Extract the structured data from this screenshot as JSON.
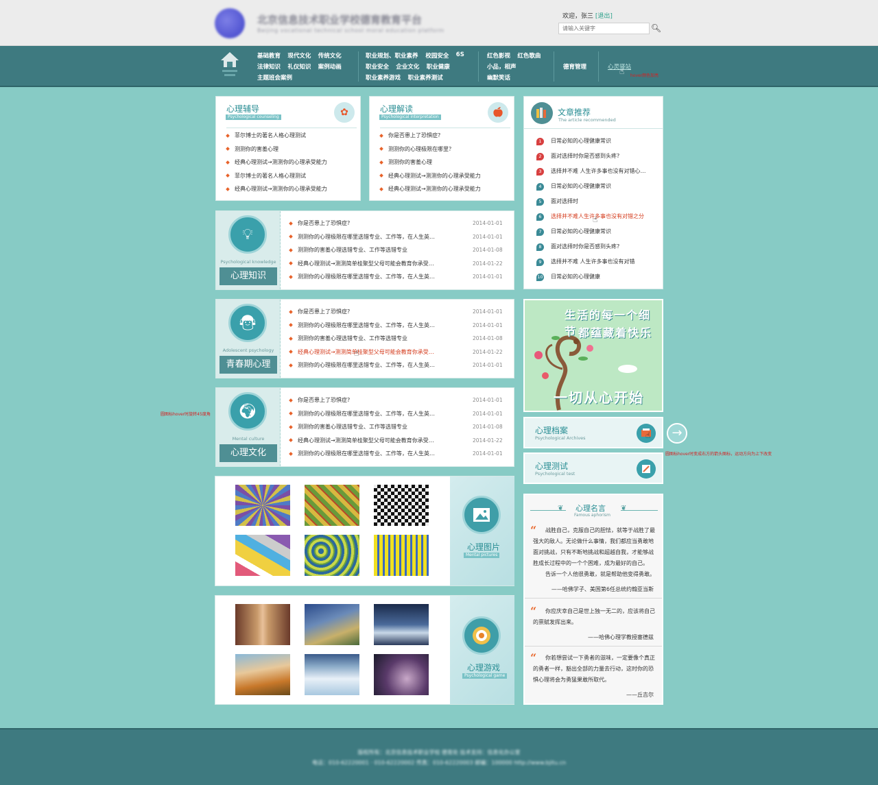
{
  "header": {
    "site_title": "北京信息技术职业学校德育教育平台",
    "site_subtitle": "Beijing vocational technical school moral education platform",
    "welcome": "欢迎，张三",
    "logout": "[退出]",
    "search_placeholder": "请输入关键字"
  },
  "nav": {
    "g1": [
      [
        "基础教育",
        "现代文化",
        "传统文化"
      ],
      [
        "法律知识",
        "礼仪知识",
        "案例动画"
      ],
      [
        "主题班会案例"
      ]
    ],
    "g2": [
      [
        "职业规划、职业素养",
        "校园安全",
        "6S"
      ],
      [
        "职业安全",
        "企业文化",
        "职业健康"
      ],
      [
        "职业素养游戏",
        "职业素养测试"
      ]
    ],
    "g3": [
      [
        "红色影视",
        "红色歌曲"
      ],
      [
        "小品，相声"
      ],
      [
        "幽默笑话"
      ]
    ],
    "g4": "德育管理",
    "g5": "心灵驿站",
    "hover_note": "hover颜色加亮"
  },
  "counseling": {
    "title": "心理辅导",
    "subtitle": "Psychological counseling",
    "items": [
      "菲尔博士的著名人格心理测试",
      "测测你的害羞心理",
      "经典心理测试→测测你的心理承受能力",
      "菲尔博士的著名人格心理测试",
      "经典心理测试→测测你的心理承受能力"
    ]
  },
  "interpretation": {
    "title": "心理解读",
    "subtitle": "Psychological interpretation",
    "items": [
      "你是否患上了恐惧症?",
      "测测你的心理极限在哪里？",
      "测测你的害羞心理",
      "经典心理测试→测测你的心理承受能力",
      "经典心理测试→测测你的心理承受能力"
    ]
  },
  "sections": [
    {
      "en": "Psychological knowledge",
      "title": "心理知识",
      "rows": [
        [
          "你是否患上了恐惧症?",
          "2014-01-01"
        ],
        [
          "测测你的心理极限在哪里选错专业、工作等，在人生英…",
          "2014-01-01"
        ],
        [
          "测测你的害羞心理选错专业、工作等选错专业",
          "2014-01-08"
        ],
        [
          "经典心理测试→测测简单桂聚型父母可能会教育你承受…",
          "2014-01-22"
        ],
        [
          "测测你的心理极限在哪里选错专业、工作等，在人生英…",
          "2014-01-01"
        ]
      ]
    },
    {
      "en": "Adolescent psychology",
      "title": "青春期心理",
      "rows": [
        [
          "你是否患上了恐惧症?",
          "2014-01-01"
        ],
        [
          "测测你的心理极限在哪里选错专业、工作等，在人生英…",
          "2014-01-01"
        ],
        [
          "测测你的害羞心理选错专业、工作等选错专业",
          "2014-01-08"
        ],
        [
          "经典心理测试→测测简单桂聚型父母可能会教育你承受…",
          "2014-01-22"
        ],
        [
          "测测你的心理极限在哪里选错专业、工作等，在人生英…",
          "2014-01-01"
        ]
      ]
    },
    {
      "en": "Mental culture",
      "title": "心理文化",
      "rows": [
        [
          "你是否患上了恐惧症?",
          "2014-01-01"
        ],
        [
          "测测你的心理极限在哪里选错专业、工作等，在人生英…",
          "2014-01-01"
        ],
        [
          "测测你的害羞心理选错专业、工作等选错专业",
          "2014-01-08"
        ],
        [
          "经典心理测试→测测简单桂聚型父母可能会教育你承受…",
          "2014-01-22"
        ],
        [
          "测测你的心理极限在哪里选错专业、工作等，在人生英…",
          "2014-01-01"
        ]
      ]
    }
  ],
  "annot_left": "圆图标hover时旋转45度角",
  "annot_right": "圆图标hover时变成右方的箭头图标，运动方向为上下改变",
  "pictures": {
    "title": "心理图片",
    "subtitle": "Mental pictures"
  },
  "games": {
    "title": "心理游戏",
    "subtitle": "Psychological game"
  },
  "recommend": {
    "title": "文章推荐",
    "subtitle": "The article recommended",
    "items": [
      "日常必知的心理健康常识",
      "面对选择时你是否感到头疼?",
      "选择并不难 人生许多事也没有对错心…",
      "日常必知的心理健康常识",
      "面对选择时",
      "选择并不难人生许多事也没有对错之分",
      "日常必知的心理健康常识",
      "面对选择时你是否感到头疼?",
      "选择并不难 人生许多事也没有对错",
      "日常必知的心理健康"
    ],
    "numbers": [
      "1",
      "2",
      "3",
      "4",
      "5",
      "6",
      "7",
      "8",
      "9",
      "10"
    ]
  },
  "banner": {
    "line1": "生活的每一个细节",
    "line2": "都蕴藏着快乐",
    "line3": "一切从心开始"
  },
  "archives": {
    "title": "心理档案",
    "subtitle": "Psychological Archives"
  },
  "test": {
    "title": "心理测试",
    "subtitle": "Psychological test"
  },
  "quotes": {
    "title": "心理名言",
    "subtitle": "Famous aphorism",
    "items": [
      {
        "text": "战胜自己，克服自己的胆怯，就等于战胜了最强大的敌人。无论做什么事情，我们都应当勇敢地面对挑战，只有不断地挑战和超越自我，才能够战胜成长过程中的一个个困难，成为最好的自己。",
        "text2": "告诉一个人他很勇敢，就是帮助他变得勇敢。",
        "author": "——哈佛学子、美国第6任总统约翰亚当斯"
      },
      {
        "text": "你应庆幸自己是世上独一无二的，应该将自己的禀赋发挥出来。",
        "author": "——哈佛心理学教授塞德兹"
      },
      {
        "text": "你若想尝试一下勇者的滋味，一定要像个真正的勇者一样，豁出全部的力量去行动，这时你的恐惧心理将会为勇猛果敢所取代。",
        "author": "——丘吉尔"
      }
    ]
  },
  "footer": {
    "line1": "版权所有：北京信息技术职业学校 德育处 技术支持：信息化办公室",
    "line2": "电话：010-62220001 · 010-62220002 传真：010-62220003 邮编：100000 http://www.bjitu.cn"
  }
}
